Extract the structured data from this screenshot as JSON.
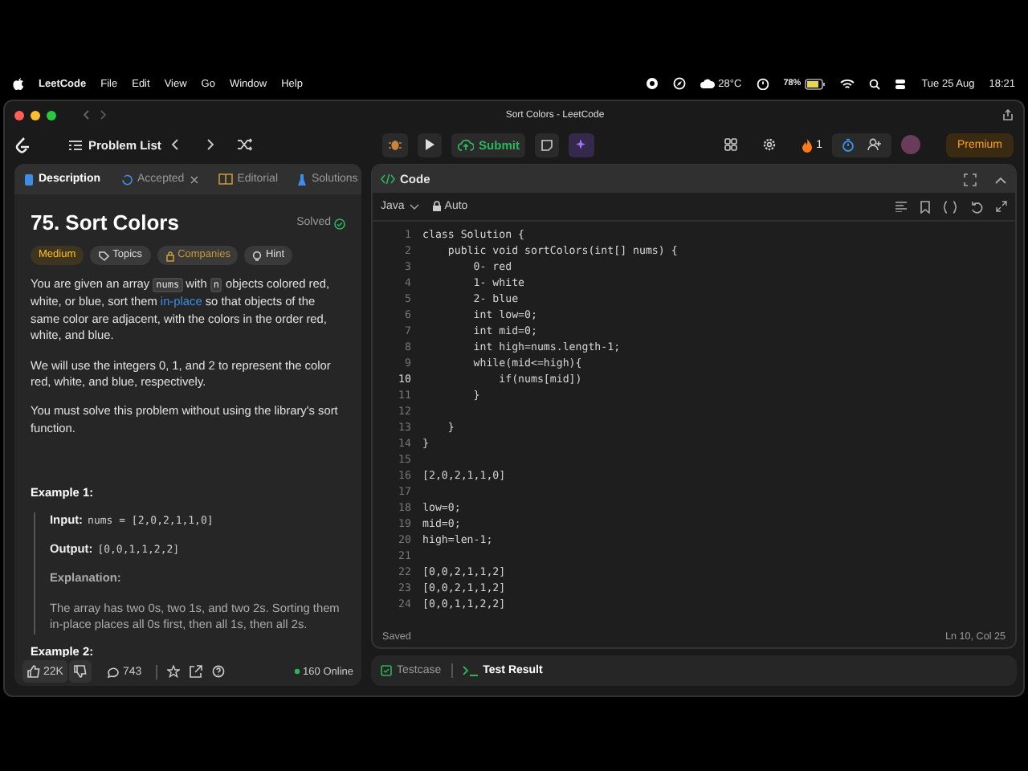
{
  "menu_bar": {
    "app": "LeetCode",
    "menus": [
      "File",
      "Edit",
      "View",
      "Go",
      "Window",
      "Help"
    ],
    "weather": "28°C",
    "battery": "78%",
    "date": "Tue 25 Aug",
    "time": "18:21"
  },
  "window": {
    "title": "Sort Colors - LeetCode"
  },
  "toolbar": {
    "problem_list": "Problem List",
    "submit": "Submit",
    "streak": "1",
    "premium": "Premium"
  },
  "description_tabs": [
    {
      "label": "Description",
      "selected": true,
      "closable": false
    },
    {
      "label": "Accepted",
      "selected": false,
      "closable": true
    },
    {
      "label": "Editorial",
      "selected": false,
      "closable": false
    },
    {
      "label": "Solutions",
      "selected": false,
      "closable": false
    }
  ],
  "problem": {
    "title": "75. Sort Colors",
    "status": "Solved",
    "tags": [
      {
        "label": "Medium",
        "kind": "difficulty"
      },
      {
        "label": "Topics",
        "kind": "topics"
      },
      {
        "label": "Companies",
        "kind": "companies"
      },
      {
        "label": "Hint",
        "kind": "hint"
      }
    ],
    "paragraphs": [
      {
        "parts": [
          {
            "kind": "text",
            "text": "You are given an array "
          },
          {
            "kind": "code",
            "text": "nums"
          },
          {
            "kind": "text",
            "text": " with "
          },
          {
            "kind": "code",
            "text": "n"
          },
          {
            "kind": "text",
            "text": " objects colored red, white, or blue, sort them "
          },
          {
            "kind": "link",
            "text": "in-place"
          },
          {
            "kind": "text",
            "text": " so that objects of the same color are adjacent, with the colors in the order red, white, and blue."
          }
        ]
      },
      {
        "parts": [
          {
            "kind": "text",
            "text": "We will use the integers 0, 1, and 2 to represent the color red, white, and blue, respectively."
          }
        ]
      },
      {
        "parts": [
          {
            "kind": "text",
            "text": "You must solve this problem without using the library's sort function."
          }
        ]
      }
    ],
    "examples": [
      {
        "heading": "Example 1:",
        "input_label": "Input:",
        "input": "nums = [2,0,2,1,1,0]",
        "output_label": "Output:",
        "output": "[0,0,1,1,2,2]",
        "explanation_label": "Explanation:",
        "explanation": "The array has two 0s, two 1s, and two 2s. Sorting them in-place places all 0s first, then all 1s, then all 2s."
      },
      {
        "heading": "Example 2:"
      }
    ]
  },
  "footer": {
    "likes": "22K",
    "comments": "743",
    "online": "160 Online"
  },
  "editor": {
    "title": "Code",
    "language": "Java",
    "mode": "Auto",
    "status": "Saved",
    "cursor": "Ln 10, Col 25",
    "lines": [
      {
        "number": "1",
        "text": "class Solution {",
        "current": false
      },
      {
        "number": "2",
        "text": "    public void sortColors(int[] nums) {",
        "current": false
      },
      {
        "number": "3",
        "text": "        0- red",
        "current": false
      },
      {
        "number": "4",
        "text": "        1- white",
        "current": false
      },
      {
        "number": "5",
        "text": "        2- blue",
        "current": false
      },
      {
        "number": "6",
        "text": "        int low=0;",
        "current": false
      },
      {
        "number": "7",
        "text": "        int mid=0;",
        "current": false
      },
      {
        "number": "8",
        "text": "        int high=nums.length-1;",
        "current": false
      },
      {
        "number": "9",
        "text": "        while(mid<=high){",
        "current": false
      },
      {
        "number": "10",
        "text": "            if(nums[mid])",
        "current": true
      },
      {
        "number": "11",
        "text": "        }",
        "current": false
      },
      {
        "number": "12",
        "current": false
      },
      {
        "number": "13",
        "text": "    }",
        "current": false
      },
      {
        "number": "14",
        "text": "}",
        "current": false
      },
      {
        "number": "15",
        "current": false
      },
      {
        "number": "16",
        "text": "[2,0,2,1,1,0]",
        "current": false
      },
      {
        "number": "17",
        "current": false
      },
      {
        "number": "18",
        "text": "low=0;",
        "current": false
      },
      {
        "number": "19",
        "text": "mid=0;",
        "current": false
      },
      {
        "number": "20",
        "text": "high=len-1;",
        "current": false
      },
      {
        "number": "21",
        "current": false
      },
      {
        "number": "22",
        "text": "[0,0,2,1,1,2]",
        "current": false
      },
      {
        "number": "23",
        "text": "[0,0,2,1,1,2]",
        "current": false
      },
      {
        "number": "24",
        "text": "[0,0,1,1,2,2]",
        "current": false
      }
    ]
  },
  "bottom_tabs": [
    {
      "label": "Testcase",
      "selected": false
    },
    {
      "label": "Test Result",
      "selected": true
    }
  ]
}
